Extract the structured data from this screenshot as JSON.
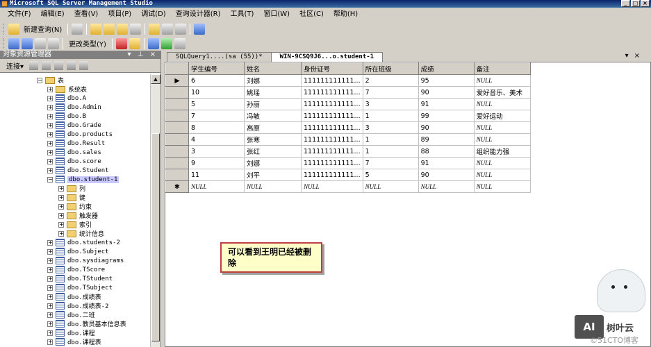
{
  "window": {
    "title": "Microsoft SQL Server Management Studio",
    "buttons": [
      "_",
      "□",
      "×"
    ]
  },
  "menu": [
    "文件(F)",
    "编辑(E)",
    "查看(V)",
    "项目(P)",
    "调试(D)",
    "查询设计器(R)",
    "工具(T)",
    "窗口(W)",
    "社区(C)",
    "帮助(H)"
  ],
  "toolbar": {
    "new_query": "新建查询(N)",
    "change_type": "更改类型(Y)"
  },
  "object_explorer": {
    "title": "对象资源管理器",
    "pin_controls": "▾ ⊥ ×",
    "connect": "连接▾",
    "nodes": [
      {
        "label": "表",
        "expander": "−",
        "kind": "folder"
      },
      {
        "label": "系统表",
        "expander": "+",
        "kind": "folder"
      },
      {
        "label": "dbo.A",
        "expander": "+",
        "kind": "table"
      },
      {
        "label": "dbo.Admin",
        "expander": "+",
        "kind": "table"
      },
      {
        "label": "dbo.B",
        "expander": "+",
        "kind": "table"
      },
      {
        "label": "dbo.Grade",
        "expander": "+",
        "kind": "table"
      },
      {
        "label": "dbo.products",
        "expander": "+",
        "kind": "table"
      },
      {
        "label": "dbo.Result",
        "expander": "+",
        "kind": "table"
      },
      {
        "label": "dbo.sales",
        "expander": "+",
        "kind": "table"
      },
      {
        "label": "dbo.score",
        "expander": "+",
        "kind": "table"
      },
      {
        "label": "dbo.Student",
        "expander": "+",
        "kind": "table"
      },
      {
        "label": "dbo.student-1",
        "expander": "−",
        "kind": "table"
      },
      {
        "label": "列",
        "expander": "+",
        "kind": "folder"
      },
      {
        "label": "键",
        "expander": "+",
        "kind": "folder"
      },
      {
        "label": "约束",
        "expander": "+",
        "kind": "folder"
      },
      {
        "label": "触发器",
        "expander": "+",
        "kind": "folder"
      },
      {
        "label": "索引",
        "expander": "+",
        "kind": "folder"
      },
      {
        "label": "统计信息",
        "expander": "+",
        "kind": "folder"
      },
      {
        "label": "dbo.students-2",
        "expander": "+",
        "kind": "table"
      },
      {
        "label": "dbo.Subject",
        "expander": "+",
        "kind": "table"
      },
      {
        "label": "dbo.sysdiagrams",
        "expander": "+",
        "kind": "table"
      },
      {
        "label": "dbo.TScore",
        "expander": "+",
        "kind": "table"
      },
      {
        "label": "dbo.TStudent",
        "expander": "+",
        "kind": "table"
      },
      {
        "label": "dbo.TSubject",
        "expander": "+",
        "kind": "table"
      },
      {
        "label": "dbo.成绩表",
        "expander": "+",
        "kind": "table"
      },
      {
        "label": "dbo.成绩表-2",
        "expander": "+",
        "kind": "table"
      },
      {
        "label": "dbo.二班",
        "expander": "+",
        "kind": "table"
      },
      {
        "label": "dbo.教员基本信息表",
        "expander": "+",
        "kind": "table"
      },
      {
        "label": "dbo.课程",
        "expander": "+",
        "kind": "table"
      },
      {
        "label": "dbo.课程表",
        "expander": "+",
        "kind": "table"
      }
    ]
  },
  "tabs": [
    {
      "label": "SQLQuery1....(sa (55))*",
      "active": false
    },
    {
      "label": "WIN-9CSQ9J6...o.student-1",
      "active": true
    }
  ],
  "tab_controls": "▾×",
  "grid": {
    "columns": [
      "学生编号",
      "姓名",
      "身份证号",
      "所在班级",
      "成绩",
      "备注"
    ],
    "rows": [
      {
        "marker": "▶",
        "cells": [
          "6",
          "刘娜",
          "111111111111...",
          "2",
          "95",
          "NULL"
        ]
      },
      {
        "marker": "",
        "cells": [
          "10",
          "姚瑶",
          "111111111111...",
          "7",
          "90",
          "爱好音乐、美术"
        ]
      },
      {
        "marker": "",
        "cells": [
          "5",
          "孙丽",
          "111111111111...",
          "3",
          "91",
          "NULL"
        ]
      },
      {
        "marker": "",
        "cells": [
          "7",
          "冯敏",
          "111111111111...",
          "1",
          "99",
          "爱好运动"
        ]
      },
      {
        "marker": "",
        "cells": [
          "8",
          "高原",
          "111111111111...",
          "3",
          "90",
          "NULL"
        ]
      },
      {
        "marker": "",
        "cells": [
          "4",
          "张寒",
          "111111111111...",
          "1",
          "89",
          "NULL"
        ]
      },
      {
        "marker": "",
        "cells": [
          "3",
          "张红",
          "111111111111...",
          "1",
          "88",
          "组织能力强"
        ]
      },
      {
        "marker": "",
        "cells": [
          "9",
          "刘娜",
          "111111111111...",
          "7",
          "91",
          "NULL"
        ]
      },
      {
        "marker": "",
        "cells": [
          "11",
          "刘平",
          "111111111111...",
          "5",
          "90",
          "NULL"
        ]
      },
      {
        "marker": "✱",
        "cells": [
          "NULL",
          "NULL",
          "NULL",
          "NULL",
          "NULL",
          "NULL"
        ]
      }
    ]
  },
  "callout": {
    "text": "可以看到王明已经被删除"
  },
  "watermark": {
    "logo": "AI",
    "name": "树叶云",
    "tag": "©51CTO博客"
  }
}
